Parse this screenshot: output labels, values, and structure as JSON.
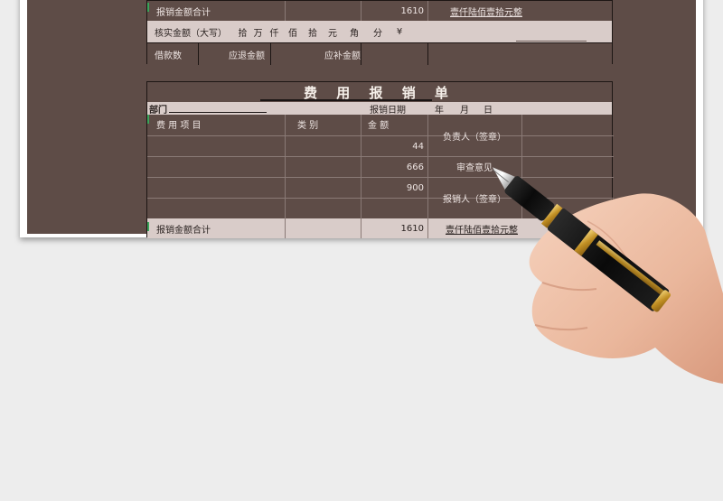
{
  "form_top": {
    "total_label": "报销金额合计",
    "total_value": "1610",
    "total_words": "壹仟陆佰壹拾元整",
    "verified_label": "核实金额（大写）",
    "units": [
      "拾",
      "万",
      "仟",
      "佰",
      "拾",
      "元",
      "角",
      "分",
      "¥"
    ],
    "loan_label": "借款数",
    "refund_label": "应退金额",
    "supplement_label": "应补金额"
  },
  "form_main": {
    "title": "费 用 报 销 单",
    "dept_label": "部门",
    "date_label": "报销日期",
    "year_label": "年",
    "month_label": "月",
    "day_label": "日",
    "col_item": "费 用 项 目",
    "col_category": "类 别",
    "col_amount": "金 额",
    "rows": [
      {
        "item": "",
        "category": "",
        "amount": "44"
      },
      {
        "item": "",
        "category": "",
        "amount": "666"
      },
      {
        "item": "",
        "category": "",
        "amount": "900"
      },
      {
        "item": "",
        "category": "",
        "amount": ""
      }
    ],
    "side_responsible": "负责人（签章）",
    "side_review": "审查意见",
    "side_reimburser": "报销人（签章）",
    "total_label": "报销金额合计",
    "total_value": "1610",
    "total_words": "壹仟陆佰壹拾元整"
  },
  "colors": {
    "board": "#5e4c47",
    "cell_light": "#d9ccc9",
    "title_text": "#f5efe9",
    "pen_body": "#111111",
    "pen_gold": "#c99a2e"
  }
}
